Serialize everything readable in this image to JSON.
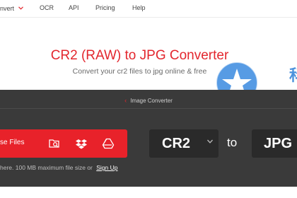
{
  "nav": {
    "items": [
      {
        "label": "nvert"
      },
      {
        "label": "OCR"
      },
      {
        "label": "API"
      },
      {
        "label": "Pricing"
      },
      {
        "label": "Help"
      }
    ]
  },
  "hero": {
    "title": "CR2 (RAW) to JPG Converter",
    "subtitle": "Convert your cr2 files to jpg online & free"
  },
  "breadcrumb": {
    "label": "Image Converter"
  },
  "upload": {
    "choose_label": "se Files",
    "icons": [
      "folder-search-icon",
      "dropbox-icon",
      "google-drive-icon"
    ]
  },
  "converter": {
    "from_format": "CR2",
    "to_label": "to",
    "to_format": "JPG"
  },
  "terms": {
    "text": "here. 100 MB maximum file size or",
    "signup_label": "Sign Up"
  },
  "watermark": {
    "glyph": "科"
  },
  "colors": {
    "brand_red": "#e3262d",
    "band_dark": "#3a3a3a",
    "select_bg": "#2a2a2a",
    "watermark_blue": "#2f7fd6"
  }
}
